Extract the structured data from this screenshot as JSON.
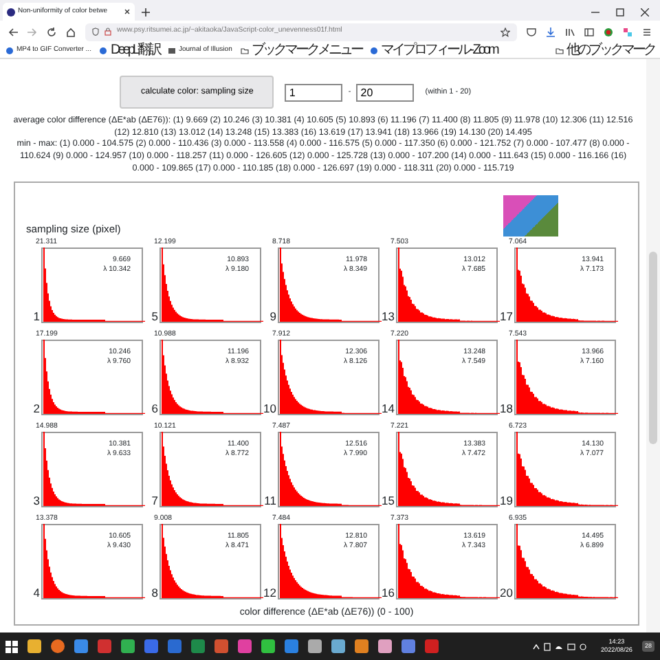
{
  "browser": {
    "tab": {
      "title": "Non-uniformity of color betwe"
    },
    "address": "www.psy.ritsumei.ac.jp/~akitaoka/JavaScript-color_unevenness01f.html",
    "bookmarks": [
      {
        "label": "MP4 to GIF Converter ...",
        "kind": "site"
      },
      {
        "label": "DeepL翻訳",
        "kind": "site"
      },
      {
        "label": "Journal of Illusion",
        "kind": "pdf"
      },
      {
        "label": "ブックマークメニュー",
        "kind": "folder"
      },
      {
        "label": "マイプロフィール - Zoom",
        "kind": "site"
      }
    ],
    "other_bookmarks": "他のブックマーク"
  },
  "controls": {
    "button": "calculate color: sampling size",
    "from": "1",
    "separator": "-",
    "to": "20",
    "hint": "(within 1 - 20)"
  },
  "results": {
    "average": "average color difference (ΔE*ab (ΔE76)): (1) 9.669 (2) 10.246 (3) 10.381 (4) 10.605 (5) 10.893 (6) 11.196 (7) 11.400 (8) 11.805 (9) 11.978 (10) 12.306 (11) 12.516 (12) 12.810 (13) 13.012 (14) 13.248 (15) 13.383 (16) 13.619 (17) 13.941 (18) 13.966 (19) 14.130 (20) 14.495",
    "minmax": "min - max: (1) 0.000 - 104.575 (2) 0.000 - 110.436 (3) 0.000 - 113.558 (4) 0.000 - 116.575 (5) 0.000 - 117.350 (6) 0.000 - 121.752 (7) 0.000 - 107.477 (8) 0.000 - 110.624 (9) 0.000 - 124.957 (10) 0.000 - 118.257 (11) 0.000 - 126.605 (12) 0.000 - 125.728 (13) 0.000 - 107.200 (14) 0.000 - 111.643 (15) 0.000 - 116.166 (16) 0.000 - 109.865 (17) 0.000 - 110.185 (18) 0.000 - 126.697 (19) 0.000 - 118.311 (20) 0.000 - 115.719"
  },
  "figure": {
    "ylabel": "sampling size (pixel)",
    "xlabel": "color difference (ΔE*ab (ΔE76)) (0 - 100)",
    "panels": [
      {
        "number": "1",
        "peak": "21.311",
        "mean": "9.669",
        "lambda": "λ 10.342"
      },
      {
        "number": "5",
        "peak": "12.199",
        "mean": "10.893",
        "lambda": "λ 9.180"
      },
      {
        "number": "9",
        "peak": "8.718",
        "mean": "11.978",
        "lambda": "λ 8.349"
      },
      {
        "number": "13",
        "peak": "7.503",
        "mean": "13.012",
        "lambda": "λ 7.685"
      },
      {
        "number": "17",
        "peak": "7.064",
        "mean": "13.941",
        "lambda": "λ 7.173"
      },
      {
        "number": "2",
        "peak": "17.199",
        "mean": "10.246",
        "lambda": "λ 9.760"
      },
      {
        "number": "6",
        "peak": "10.988",
        "mean": "11.196",
        "lambda": "λ 8.932"
      },
      {
        "number": "10",
        "peak": "7.912",
        "mean": "12.306",
        "lambda": "λ 8.126"
      },
      {
        "number": "14",
        "peak": "7.220",
        "mean": "13.248",
        "lambda": "λ 7.549"
      },
      {
        "number": "18",
        "peak": "7.543",
        "mean": "13.966",
        "lambda": "λ 7.160"
      },
      {
        "number": "3",
        "peak": "14.988",
        "mean": "10.381",
        "lambda": "λ 9.633"
      },
      {
        "number": "7",
        "peak": "10.121",
        "mean": "11.400",
        "lambda": "λ 8.772"
      },
      {
        "number": "11",
        "peak": "7.487",
        "mean": "12.516",
        "lambda": "λ 7.990"
      },
      {
        "number": "15",
        "peak": "7.221",
        "mean": "13.383",
        "lambda": "λ 7.472"
      },
      {
        "number": "19",
        "peak": "6.723",
        "mean": "14.130",
        "lambda": "λ 7.077"
      },
      {
        "number": "4",
        "peak": "13.378",
        "mean": "10.605",
        "lambda": "λ 9.430"
      },
      {
        "number": "8",
        "peak": "9.008",
        "mean": "11.805",
        "lambda": "λ 8.471"
      },
      {
        "number": "12",
        "peak": "7.484",
        "mean": "12.810",
        "lambda": "λ 7.807"
      },
      {
        "number": "16",
        "peak": "7.373",
        "mean": "13.619",
        "lambda": "λ 7.343"
      },
      {
        "number": "20",
        "peak": "6.935",
        "mean": "14.495",
        "lambda": "λ 6.899"
      }
    ]
  },
  "taskbar": {
    "time": "14:23",
    "date": "2022/08/26",
    "notifications": "28"
  }
}
